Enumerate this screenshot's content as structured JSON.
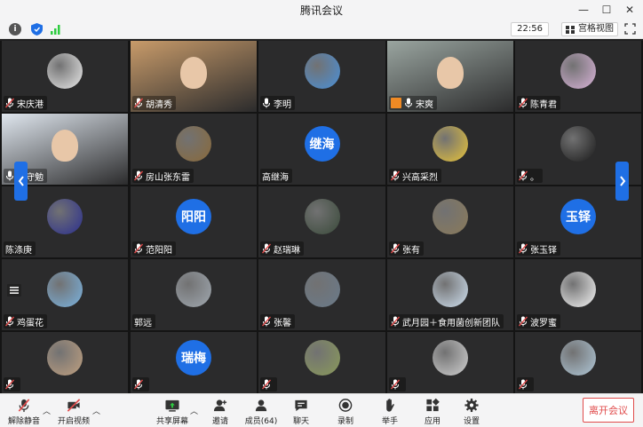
{
  "window": {
    "title": "腾讯会议",
    "min_label": "—",
    "max_label": "☐",
    "close_label": "✕"
  },
  "infobar": {
    "info_label": "i",
    "time": "22:56",
    "view_label": "宫格视图"
  },
  "participants": [
    {
      "name": "宋庆港",
      "mic": "muted",
      "avatar": "image"
    },
    {
      "name": "胡清秀",
      "mic": "muted",
      "avatar": "video"
    },
    {
      "name": "李明",
      "mic": "on",
      "avatar": "image"
    },
    {
      "name": "宋爽",
      "mic": "on",
      "avatar": "video",
      "host": true,
      "active": true
    },
    {
      "name": "陈青君",
      "mic": "muted",
      "avatar": "image"
    },
    {
      "name": "李守勉",
      "mic": "on",
      "avatar": "video"
    },
    {
      "name": "房山张东雷",
      "mic": "muted",
      "avatar": "image"
    },
    {
      "name": "高继海",
      "mic": "none",
      "avatar": "text",
      "avatar_text": "继海"
    },
    {
      "name": "兴高采烈",
      "mic": "muted",
      "avatar": "image"
    },
    {
      "name": "。",
      "mic": "muted",
      "avatar": "image"
    },
    {
      "name": "陈涤庚",
      "mic": "none",
      "avatar": "image"
    },
    {
      "name": "范阳阳",
      "mic": "muted",
      "avatar": "text",
      "avatar_text": "阳阳"
    },
    {
      "name": "赵瑞琳",
      "mic": "muted",
      "avatar": "image"
    },
    {
      "name": "张有",
      "mic": "muted",
      "avatar": "image"
    },
    {
      "name": "张玉铎",
      "mic": "muted",
      "avatar": "text",
      "avatar_text": "玉铎"
    },
    {
      "name": "鸡蛋花",
      "mic": "muted",
      "avatar": "image"
    },
    {
      "name": "郭远",
      "mic": "none",
      "avatar": "image"
    },
    {
      "name": "张馨",
      "mic": "muted",
      "avatar": "image"
    },
    {
      "name": "武月园＋食用菌创新团队",
      "mic": "muted",
      "avatar": "image"
    },
    {
      "name": "波罗蜜",
      "mic": "muted",
      "avatar": "image"
    },
    {
      "name": "",
      "mic": "muted",
      "avatar": "image"
    },
    {
      "name": "",
      "mic": "muted",
      "avatar": "text",
      "avatar_text": "瑞梅"
    },
    {
      "name": "",
      "mic": "muted",
      "avatar": "image"
    },
    {
      "name": "",
      "mic": "muted",
      "avatar": "image"
    },
    {
      "name": "",
      "mic": "muted",
      "avatar": "image"
    }
  ],
  "avatar_colors": [
    "#eaeaea",
    "#c89b6a",
    "#4a90d9",
    "#9aa5a0",
    "#d9b3d9",
    "#dfe6ee",
    "#8a6a3a",
    "#1f6fe5",
    "#e7c33a",
    "#1a1a1a",
    "#2b2f8f",
    "#1f6fe5",
    "#3a4a3a",
    "#8a7a5a",
    "#1f6fe5",
    "#7ab3e0",
    "#a0a8b0",
    "#6a7a8a",
    "#cfe0f0",
    "#f5f5f5",
    "#c0a080",
    "#1f6fe5",
    "#8a9a5a",
    "#d0d0d0",
    "#b0c8d8"
  ],
  "toolbar": {
    "unmute_label": "解除静音",
    "video_label": "开启视频",
    "share_label": "共享屏幕",
    "invite_label": "邀请",
    "members_label": "成员(64)",
    "chat_label": "聊天",
    "record_label": "录制",
    "raise_label": "举手",
    "apps_label": "应用",
    "settings_label": "设置",
    "leave_label": "离开会议"
  }
}
